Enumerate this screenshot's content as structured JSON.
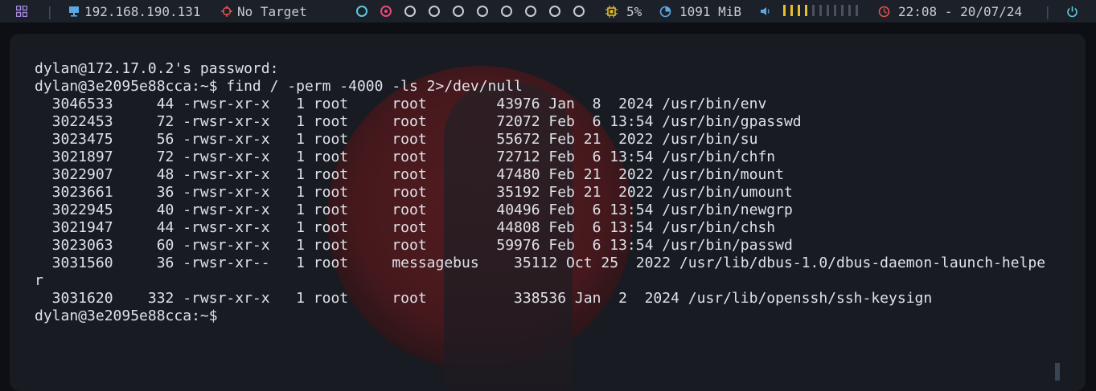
{
  "topbar": {
    "ip_address": "192.168.190.131",
    "target": "No Target",
    "cpu": "5%",
    "memory": "1091 MiB",
    "datetime": "22:08 - 20/07/24",
    "separator": "|",
    "workspaces": [
      {
        "state": "active-cyan"
      },
      {
        "state": "active-pink"
      },
      {
        "state": "empty"
      },
      {
        "state": "empty"
      },
      {
        "state": "empty"
      },
      {
        "state": "empty"
      },
      {
        "state": "empty"
      },
      {
        "state": "empty"
      },
      {
        "state": "empty"
      },
      {
        "state": "empty"
      }
    ],
    "volume_fraction": 0.4,
    "colors": {
      "bar_bg": "#1c2029",
      "ip_icon": "#5aa9e6",
      "target_icon": "#e0524f",
      "cpu_icon": "#e6c02a",
      "mem_icon": "#5aa9e6",
      "vol_on": "#e6c02a",
      "vol_off": "#4a5060",
      "clock_icon": "#e0524f",
      "power_icon": "#5fc8d8"
    }
  },
  "terminal": {
    "lines": [
      "dylan@172.17.0.2's password:",
      "dylan@3e2095e88cca:~$ find / -perm -4000 -ls 2>/dev/null",
      "  3046533     44 -rwsr-xr-x   1 root     root        43976 Jan  8  2024 /usr/bin/env",
      "  3022453     72 -rwsr-xr-x   1 root     root        72072 Feb  6 13:54 /usr/bin/gpasswd",
      "  3023475     56 -rwsr-xr-x   1 root     root        55672 Feb 21  2022 /usr/bin/su",
      "  3021897     72 -rwsr-xr-x   1 root     root        72712 Feb  6 13:54 /usr/bin/chfn",
      "  3022907     48 -rwsr-xr-x   1 root     root        47480 Feb 21  2022 /usr/bin/mount",
      "  3023661     36 -rwsr-xr-x   1 root     root        35192 Feb 21  2022 /usr/bin/umount",
      "  3022945     40 -rwsr-xr-x   1 root     root        40496 Feb  6 13:54 /usr/bin/newgrp",
      "  3021947     44 -rwsr-xr-x   1 root     root        44808 Feb  6 13:54 /usr/bin/chsh",
      "  3023063     60 -rwsr-xr-x   1 root     root        59976 Feb  6 13:54 /usr/bin/passwd",
      "  3031560     36 -rwsr-xr--   1 root     messagebus    35112 Oct 25  2022 /usr/lib/dbus-1.0/dbus-daemon-launch-helpe",
      "r",
      "  3031620    332 -rwsr-xr-x   1 root     root          338536 Jan  2  2024 /usr/lib/openssh/ssh-keysign",
      "dylan@3e2095e88cca:~$"
    ]
  }
}
